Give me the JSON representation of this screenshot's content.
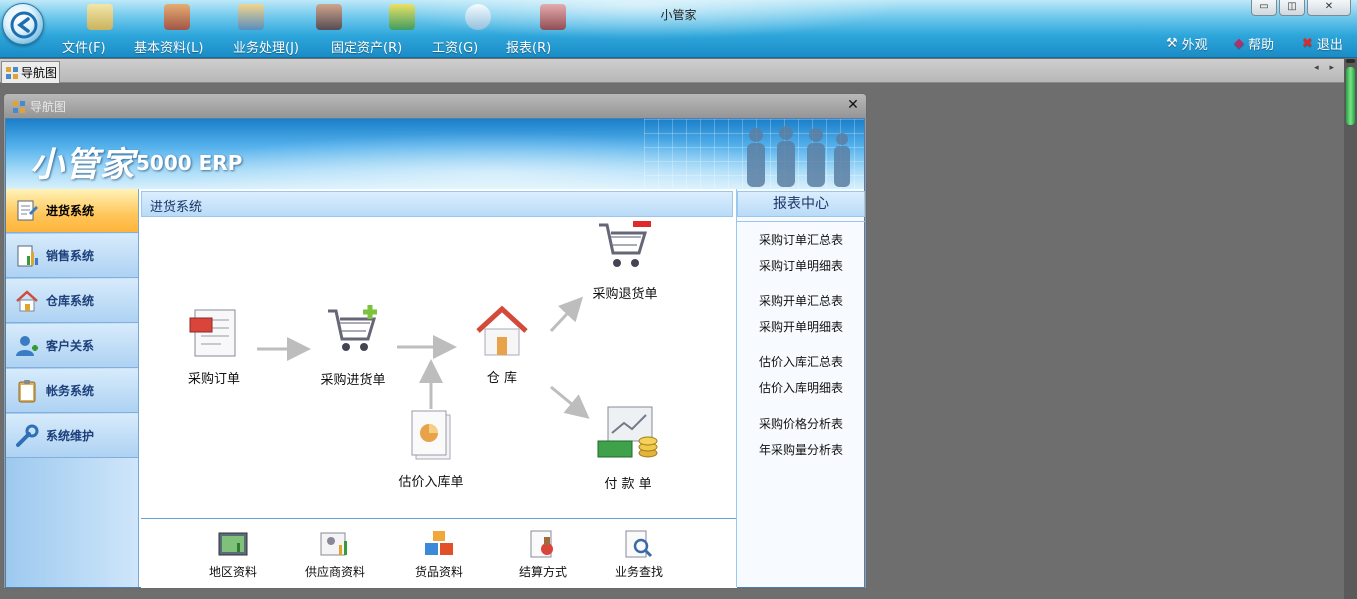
{
  "window": {
    "title": "小管家",
    "min_glyph": "▭",
    "max_glyph": "◫",
    "close_glyph": "✕"
  },
  "menu": [
    "文件(F)",
    "基本资料(L)",
    "业务处理(J)",
    "固定资产(R)",
    "工资(G)",
    "报表(R)"
  ],
  "right_menu": {
    "appearance": "外观",
    "help": "帮助",
    "exit": "退出"
  },
  "tab": {
    "label": "导航图",
    "arrows": "◂ ▸"
  },
  "nav_window": {
    "title": "导航图",
    "close_glyph": "✕"
  },
  "banner": {
    "brand": "小管家",
    "product": "5000 ERP"
  },
  "systems": [
    "进货系统",
    "销售系统",
    "仓库系统",
    "客户关系",
    "帐务系统",
    "系统维护"
  ],
  "active_system": "进货系统",
  "section_title": "进货系统",
  "flow": {
    "purchase_order": "采购订单",
    "purchase_receipt": "采购进货单",
    "warehouse": "仓 库",
    "purchase_return": "采购退货单",
    "estimated_receipt": "估价入库单",
    "payment": "付 款 单"
  },
  "bottom_items": [
    "地区资料",
    "供应商资料",
    "货品资料",
    "结算方式",
    "业务查找"
  ],
  "report_center": {
    "title": "报表中心",
    "links": [
      "采购订单汇总表",
      "采购订单明细表",
      "采购开单汇总表",
      "采购开单明细表",
      "估价入库汇总表",
      "估价入库明细表",
      "采购价格分析表",
      "年采购量分析表"
    ]
  },
  "colors": {
    "accent": "#2ea6da",
    "active_item": "#ffc65a",
    "panel_border": "#9cc7ec"
  }
}
